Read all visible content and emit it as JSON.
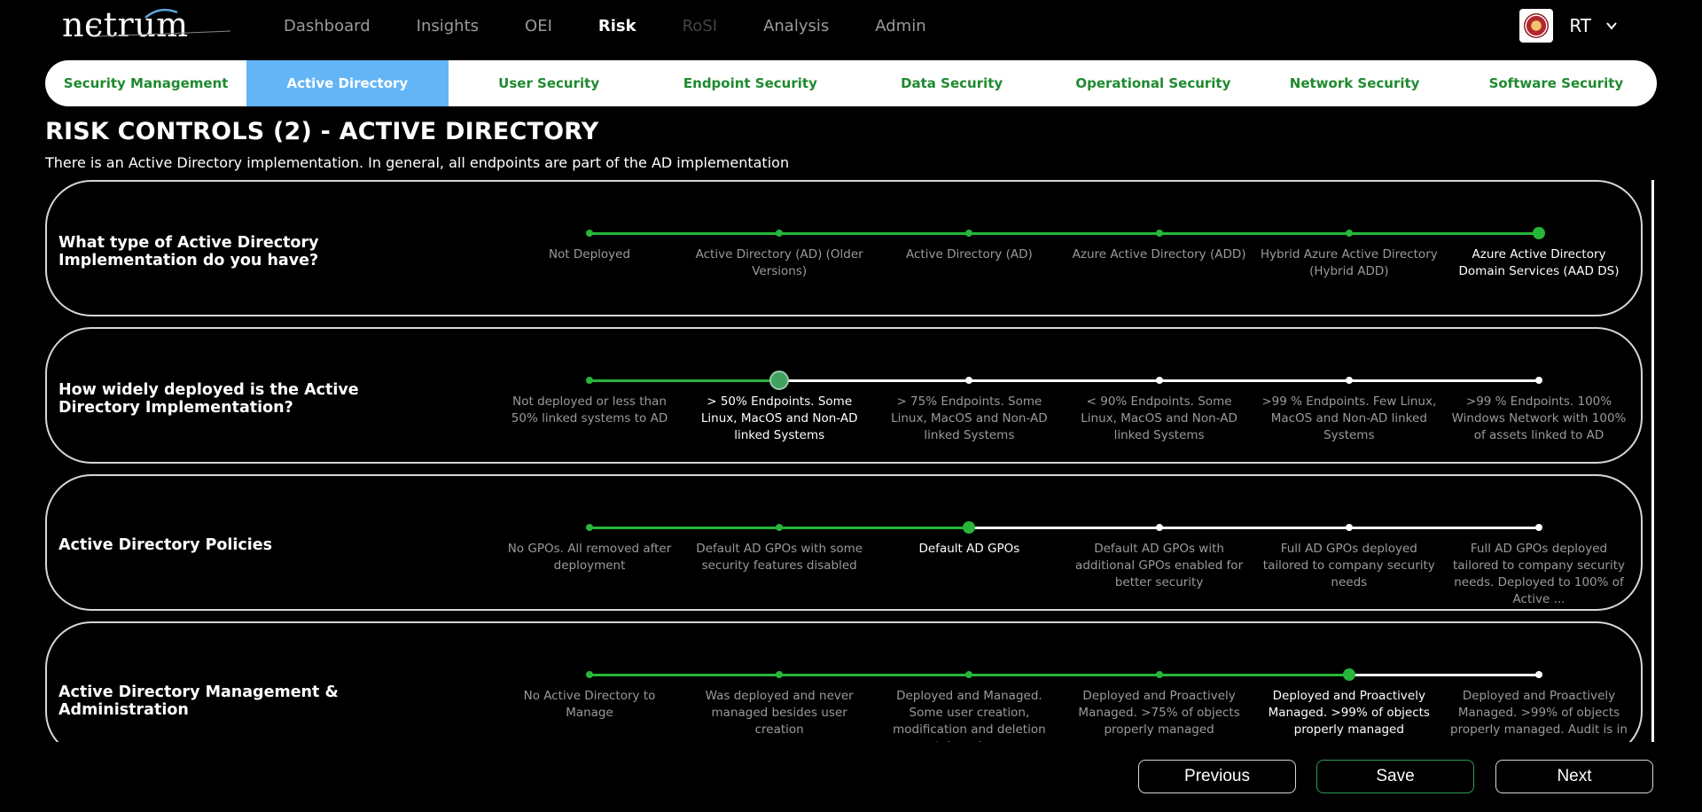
{
  "app": {
    "logo_text": "nєtrum",
    "nav": [
      {
        "label": "Dashboard",
        "state": "normal"
      },
      {
        "label": "Insights",
        "state": "normal"
      },
      {
        "label": "OEI",
        "state": "normal"
      },
      {
        "label": "Risk",
        "state": "active"
      },
      {
        "label": "RoSI",
        "state": "disabled"
      },
      {
        "label": "Analysis",
        "state": "normal"
      },
      {
        "label": "Admin",
        "state": "normal"
      }
    ],
    "user": {
      "initials": "RT",
      "avatar_icon": "org-seal-icon",
      "menu_icon": "chevron-down-icon"
    }
  },
  "tabs": [
    {
      "label": "Security Management",
      "active": false
    },
    {
      "label": "Active Directory",
      "active": true
    },
    {
      "label": "User Security",
      "active": false
    },
    {
      "label": "Endpoint Security",
      "active": false
    },
    {
      "label": "Data Security",
      "active": false
    },
    {
      "label": "Operational Security",
      "active": false
    },
    {
      "label": "Network Security",
      "active": false
    },
    {
      "label": "Software Security",
      "active": false
    }
  ],
  "page": {
    "title": "RISK CONTROLS (2) - ACTIVE DIRECTORY",
    "subtitle": "There is an Active Directory implementation. In general, all endpoints are part of the AD implementation"
  },
  "questions": [
    {
      "label": "What type of Active Directory Implementation do you have?",
      "selected_index": 5,
      "options": [
        "Not Deployed",
        "Active Directory (AD) (Older Versions)",
        "Active Directory (AD)",
        "Azure Active Directory (ADD)",
        "Hybrid Azure Active Directory (Hybrid ADD)",
        "Azure Active Directory Domain Services (AAD DS)"
      ]
    },
    {
      "label": "How widely deployed is the Active Directory Implementation?",
      "selected_index": 1,
      "focused": true,
      "options": [
        "Not deployed or less than 50% linked systems to AD",
        "> 50% Endpoints. Some Linux, MacOS and Non-AD linked Systems",
        "> 75% Endpoints. Some Linux, MacOS and Non-AD linked Systems",
        "< 90% Endpoints. Some Linux, MacOS and Non-AD linked Systems",
        ">99 % Endpoints. Few Linux, MacOS and Non-AD linked Systems",
        ">99 % Endpoints. 100% Windows Network with 100% of assets linked to AD"
      ]
    },
    {
      "label": "Active Directory Policies",
      "selected_index": 2,
      "options": [
        "No GPOs. All removed after deployment",
        "Default AD GPOs with some security features disabled",
        "Default AD GPOs",
        "Default AD GPOs with additional GPOs enabled for better security",
        "Full AD GPOs deployed tailored to company security needs",
        "Full AD GPOs deployed tailored to company security needs. Deployed to 100% of Active ..."
      ]
    },
    {
      "label": "Active Directory Management & Administration",
      "selected_index": 4,
      "options": [
        "No Active Directory to Manage",
        "Was deployed and never managed besides user creation",
        "Deployed and Managed. Some user creation, modification and deletion takes place",
        "Deployed and Proactively Managed.  >75% of objects properly managed",
        "Deployed and Proactively Managed.  >99% of objects properly managed",
        "Deployed and Proactively Managed.  >99% of objects properly managed. Audit is in ..."
      ]
    }
  ],
  "buttons": {
    "previous": "Previous",
    "save": "Save",
    "next": "Next"
  },
  "colors": {
    "accent_green": "#27b53a",
    "tab_text_green": "#1e8a2f",
    "active_tab_blue": "#64b5f6",
    "background": "#000000"
  }
}
